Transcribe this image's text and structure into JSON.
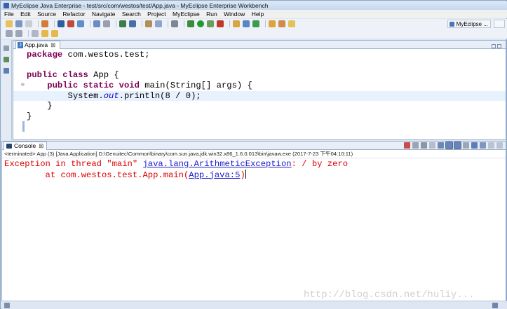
{
  "window": {
    "title": "MyEclipse Java Enterprise - test/src/com/westos/test/App.java - MyEclipse Enterprise Workbench"
  },
  "menu": [
    "File",
    "Edit",
    "Source",
    "Refactor",
    "Navigate",
    "Search",
    "Project",
    "MyEclipse",
    "Run",
    "Window",
    "Help"
  ],
  "perspective": {
    "label": "MyEclipse ..."
  },
  "editor": {
    "tab_label": "App.java",
    "tab_close": "⊠",
    "code_lines": [
      {
        "kw": "package",
        "rest": " com.westos.test;"
      },
      {
        "kw": "",
        "rest": ""
      },
      {
        "kw": "public class",
        "rest": " App {"
      },
      {
        "indent": "    ",
        "kw": "public static void",
        "rest": " main(String[] args) {"
      },
      {
        "indent": "        ",
        "pre": "System.",
        "it": "out",
        "post": ".println(8 / 0);"
      },
      {
        "indent": "    ",
        "rest": "}"
      },
      {
        "rest": "}"
      }
    ]
  },
  "console": {
    "tab_label": "Console",
    "tab_close": "⊠",
    "terminated": "<terminated> App (3) [Java Application] D:\\Genuitec\\Common\\binary\\com.sun.java.jdk.win32.x86_1.6.0.013\\bin\\javaw.exe (2017-7-23 下午04:10:11)",
    "line1_prefix": "Exception in thread \"main\" ",
    "line1_link": "java.lang.ArithmeticException",
    "line1_suffix": ": / by zero",
    "line2_prefix": "        at com.westos.test.App.main(",
    "line2_link": "App.java:5",
    "line2_suffix": ")"
  },
  "watermark": "http://blog.csdn.net/huliy...",
  "colors": {
    "keyword": "#7f0055",
    "static_field": "#0000c0",
    "error": "#e00000",
    "link": "#1a1acc"
  }
}
